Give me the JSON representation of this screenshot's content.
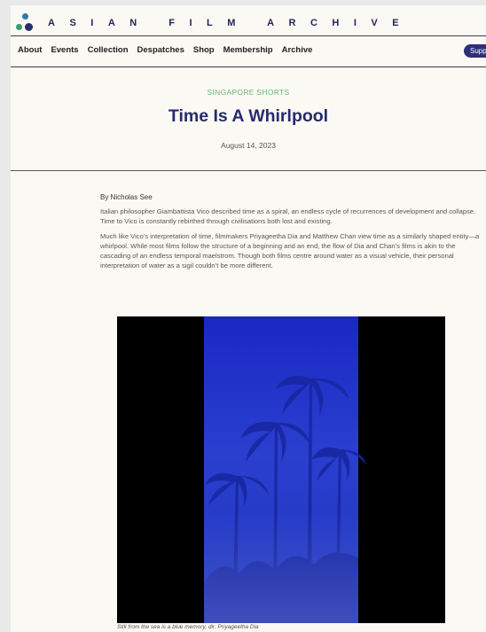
{
  "brand": {
    "name": "ASIAN FILM ARCHIVE",
    "logo_icon": "logo-icon"
  },
  "nav": {
    "items": [
      "About",
      "Events",
      "Collection",
      "Despatches",
      "Shop",
      "Membership",
      "Archive"
    ],
    "support_label": "Supp"
  },
  "article": {
    "category": "SINGAPORE SHORTS",
    "title": "Time Is A Whirlpool",
    "date": "August 14, 2023",
    "byline": "By Nicholas See",
    "paragraphs": [
      "Italian philosopher Giambattista Vico described time as a spiral, an endless cycle of recurrences of development and collapse. Time to Vico is constantly rebirthed through civilisations both lost and existing.",
      "Much like Vico’s interpretation of time, filmmakers Priyageetha Dia and Matthew Chan view time as a similarly shaped entity—a whirlpool. While most films follow the structure of a beginning and an end, the flow of Dia and Chan’s films is akin to the cascading of an endless temporal maelstrom. Though both films centre around water as a visual vehicle, their personal interpretation of water as a sigil couldn’t be more different."
    ],
    "caption": "Still from the sea is a blue memory, dir. Priyageetha Dia"
  },
  "colors": {
    "brand_navy": "#262b6b",
    "category_green": "#6ab96f",
    "image_blue": "#2130b8",
    "page_bg": "#fbf9f4"
  }
}
